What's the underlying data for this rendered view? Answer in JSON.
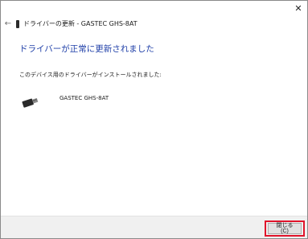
{
  "window": {
    "close_glyph": "✕",
    "back_glyph": "←",
    "title": "ドライバーの更新 - GASTEC GHS-8AT"
  },
  "main": {
    "headline": "ドライバーが正常に更新されました",
    "subtext": "このデバイス用のドライバーがインストールされました:",
    "device_name": "GASTEC GHS-8AT",
    "device_icon": "usb-device-icon"
  },
  "footer": {
    "close_label": "閉じる(C)"
  },
  "colors": {
    "headline": "#1f3fa8",
    "highlight": "#e0142b",
    "footer_bg": "#f0f0f0"
  }
}
